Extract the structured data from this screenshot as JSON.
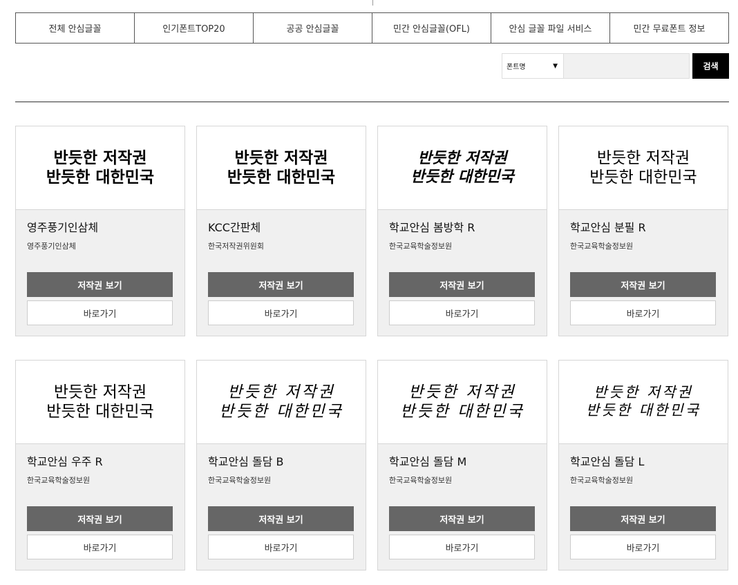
{
  "tabs": [
    {
      "label": "전체 안심글꼴"
    },
    {
      "label": "인기폰트TOP20"
    },
    {
      "label": "공공 안심글꼴"
    },
    {
      "label": "민간 안심글꼴(OFL)"
    },
    {
      "label": "안심 글꼴 파일 서비스"
    },
    {
      "label": "민간 무료폰트 정보"
    }
  ],
  "search": {
    "select_value": "폰트명",
    "caret": "▼",
    "input_value": "",
    "button_label": "검색"
  },
  "cards": [
    {
      "preview_line1": "반듯한 저작권",
      "preview_line2": "반듯한 대한민국",
      "name": "영주풍기인삼체",
      "maker": "영주풍기인삼체",
      "copyright_label": "저작권 보기",
      "go_label": "바로가기"
    },
    {
      "preview_line1": "반듯한 저작권",
      "preview_line2": "반듯한 대한민국",
      "name": "KCC간판체",
      "maker": "한국저작권위원회",
      "copyright_label": "저작권 보기",
      "go_label": "바로가기"
    },
    {
      "preview_line1": "반듯한 저작권",
      "preview_line2": "반듯한 대한민국",
      "name": "학교안심 봄방학 R",
      "maker": "한국교육학술정보원",
      "copyright_label": "저작권 보기",
      "go_label": "바로가기"
    },
    {
      "preview_line1": "반듯한 저작권",
      "preview_line2": "반듯한 대한민국",
      "name": "학교안심 분필 R",
      "maker": "한국교육학술정보원",
      "copyright_label": "저작권 보기",
      "go_label": "바로가기"
    },
    {
      "preview_line1": "반듯한 저작권",
      "preview_line2": "반듯한 대한민국",
      "name": "학교안심 우주 R",
      "maker": "한국교육학술정보원",
      "copyright_label": "저작권 보기",
      "go_label": "바로가기"
    },
    {
      "preview_line1": "반듯한 저작권",
      "preview_line2": "반듯한 대한민국",
      "name": "학교안심 돌담 B",
      "maker": "한국교육학술정보원",
      "copyright_label": "저작권 보기",
      "go_label": "바로가기"
    },
    {
      "preview_line1": "반듯한 저작권",
      "preview_line2": "반듯한 대한민국",
      "name": "학교안심 돌담 M",
      "maker": "한국교육학술정보원",
      "copyright_label": "저작권 보기",
      "go_label": "바로가기"
    },
    {
      "preview_line1": "반듯한 저작권",
      "preview_line2": "반듯한 대한민국",
      "name": "학교안심 돌담 L",
      "maker": "한국교육학술정보원",
      "copyright_label": "저작권 보기",
      "go_label": "바로가기"
    }
  ]
}
